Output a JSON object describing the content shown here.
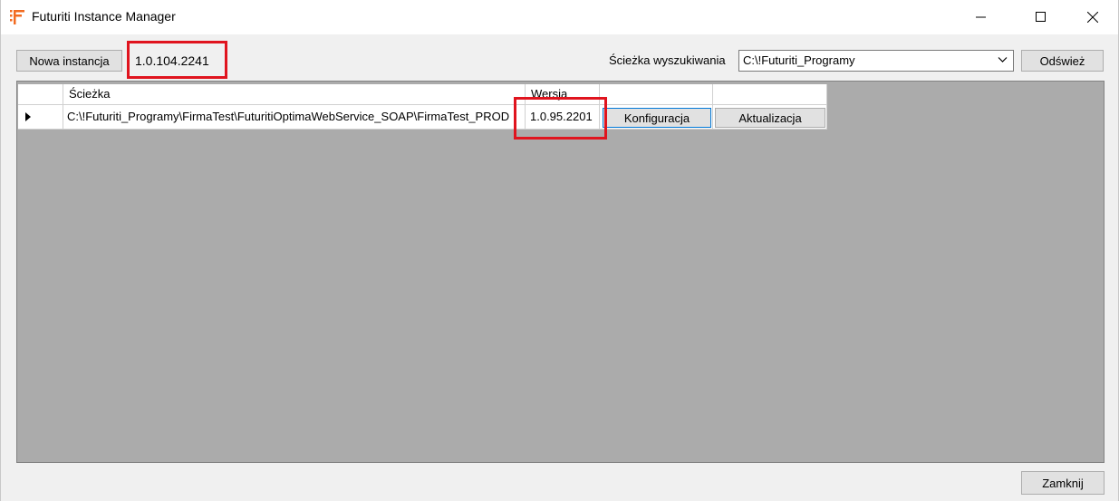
{
  "window": {
    "title": "Futuriti Instance Manager",
    "controls": {
      "minimize": "minimize-icon",
      "maximize": "maximize-icon",
      "close": "close-icon"
    }
  },
  "toolbar": {
    "new_instance_label": "Nowa instancja",
    "manager_version": "1.0.104.2241",
    "search_path_label": "Ścieżka wyszukiwania",
    "search_path_value": "C:\\!Futuriti_Programy",
    "refresh_label": "Odśwież"
  },
  "grid": {
    "columns": [
      "Ścieżka",
      "Wersja",
      "",
      ""
    ],
    "rows": [
      {
        "path": "C:\\!Futuriti_Programy\\FirmaTest\\FuturitiOptimaWebService_SOAP\\FirmaTest_PROD",
        "version": "1.0.95.2201",
        "config_label": "Konfiguracja",
        "update_label": "Aktualizacja"
      }
    ]
  },
  "footer": {
    "close_label": "Zamknij"
  },
  "colors": {
    "highlight": "#e0141e",
    "accent": "#0078d7",
    "grid_background": "#ababab",
    "brand": "#f26b21"
  }
}
